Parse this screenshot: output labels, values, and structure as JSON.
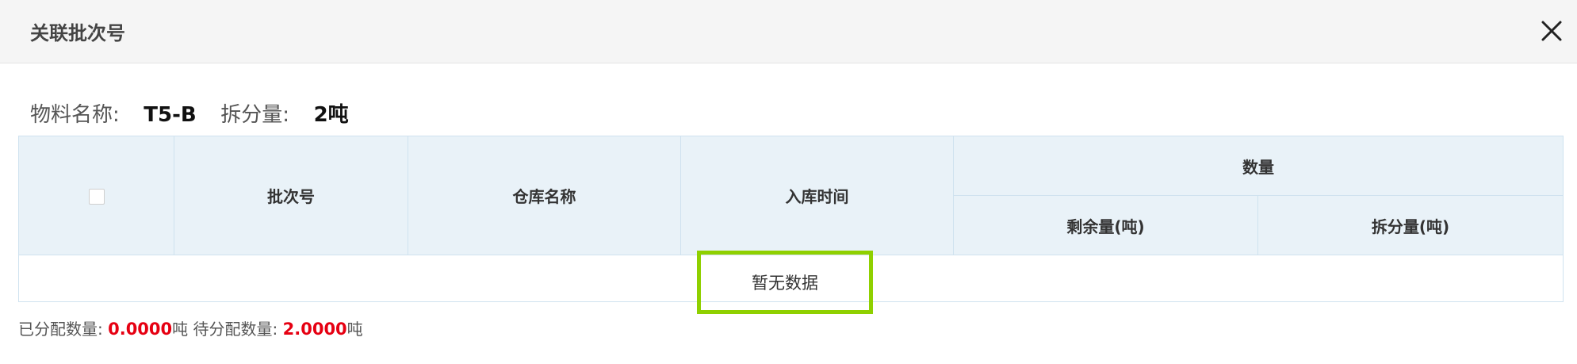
{
  "dialog": {
    "title": "关联批次号",
    "close_icon": "close-icon"
  },
  "info": {
    "material_label": "物料名称:",
    "material_value": "T5-B",
    "split_label": "拆分量:",
    "split_value": "2吨"
  },
  "table": {
    "columns": {
      "batch_no": "批次号",
      "warehouse": "仓库名称",
      "in_time": "入库时间",
      "quantity": "数量",
      "remaining": "剩余量(吨)",
      "split": "拆分量(吨)"
    },
    "empty_text": "暂无数据"
  },
  "summary": {
    "assigned_label": "已分配数量:",
    "assigned_value": "0.0000",
    "assigned_unit": "吨",
    "pending_label": "待分配数量:",
    "pending_value": "2.0000",
    "pending_unit": "吨"
  },
  "colors": {
    "header_bg": "#f5f5f5",
    "table_header_bg": "#e9f2f8",
    "highlight_border": "#8fd000",
    "value_red": "#e60012"
  }
}
